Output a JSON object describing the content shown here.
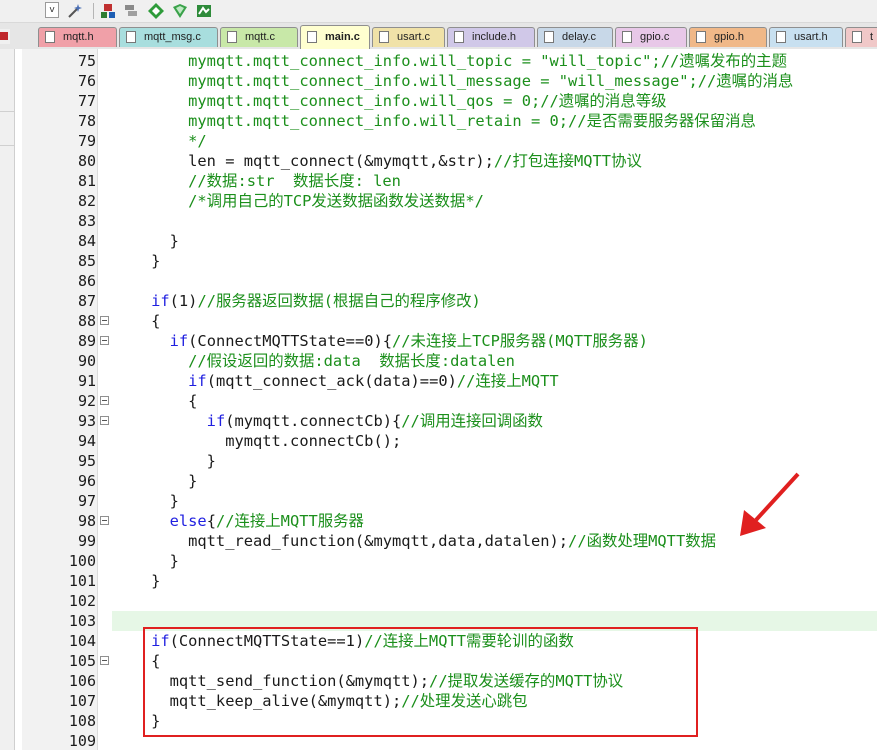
{
  "toolbar": {
    "dropdown_glyph": "v",
    "icons": [
      "dropdown-icon",
      "magic-wand-icon",
      "build-icon",
      "build-all-icon",
      "rebuild-icon",
      "download-icon",
      "options-icon"
    ]
  },
  "tabs": [
    {
      "label": "mqtt.h",
      "color": "#f0a0a8",
      "active": false
    },
    {
      "label": "mqtt_msg.c",
      "color": "#a8dede",
      "active": false
    },
    {
      "label": "mqtt.c",
      "color": "#c8e8a8",
      "active": false
    },
    {
      "label": "main.c",
      "color": "#ffffd0",
      "active": true
    },
    {
      "label": "usart.c",
      "color": "#f0e2a8",
      "active": false
    },
    {
      "label": "include.h",
      "color": "#d0c8e8",
      "active": false
    },
    {
      "label": "delay.c",
      "color": "#c8d8e8",
      "active": false
    },
    {
      "label": "gpio.c",
      "color": "#e8c8e8",
      "active": false
    },
    {
      "label": "gpio.h",
      "color": "#f0b888",
      "active": false
    },
    {
      "label": "usart.h",
      "color": "#c8e0f0",
      "active": false
    },
    {
      "label": "t",
      "color": "#f0c8c8",
      "active": false
    }
  ],
  "editor": {
    "current_line_highlight": 103,
    "lines": [
      {
        "n": "75",
        "fold": false,
        "segs": [
          {
            "t": "        mymqtt.mqtt_connect_info.will_topic = \"will_topic\";//遗嘱发布的主题",
            "c": "c-green"
          }
        ]
      },
      {
        "n": "76",
        "fold": false,
        "segs": [
          {
            "t": "        mymqtt.mqtt_connect_info.will_message = \"will_message\";//遗嘱的消息",
            "c": "c-green"
          }
        ]
      },
      {
        "n": "77",
        "fold": false,
        "segs": [
          {
            "t": "        mymqtt.mqtt_connect_info.will_qos = 0;//遗嘱的消息等级",
            "c": "c-green"
          }
        ]
      },
      {
        "n": "78",
        "fold": false,
        "segs": [
          {
            "t": "        mymqtt.mqtt_connect_info.will_retain = 0;//是否需要服务器保留消息",
            "c": "c-green"
          }
        ]
      },
      {
        "n": "79",
        "fold": false,
        "segs": [
          {
            "t": "        */",
            "c": "c-green"
          }
        ]
      },
      {
        "n": "80",
        "fold": false,
        "segs": [
          {
            "t": "        len = mqtt_connect(&mymqtt,&str);",
            "c": "c-black"
          },
          {
            "t": "//打包连接MQTT协议",
            "c": "c-green"
          }
        ]
      },
      {
        "n": "81",
        "fold": false,
        "segs": [
          {
            "t": "        //数据:str  数据长度: len",
            "c": "c-green"
          }
        ]
      },
      {
        "n": "82",
        "fold": false,
        "segs": [
          {
            "t": "        /*调用自己的TCP发送数据函数发送数据*/",
            "c": "c-green"
          }
        ]
      },
      {
        "n": "83",
        "fold": false,
        "segs": []
      },
      {
        "n": "84",
        "fold": false,
        "segs": [
          {
            "t": "      }",
            "c": "c-black"
          }
        ]
      },
      {
        "n": "85",
        "fold": false,
        "segs": [
          {
            "t": "    }",
            "c": "c-black"
          }
        ]
      },
      {
        "n": "86",
        "fold": false,
        "segs": []
      },
      {
        "n": "87",
        "fold": false,
        "segs": [
          {
            "t": "    ",
            "c": "c-black"
          },
          {
            "t": "if",
            "c": "kw"
          },
          {
            "t": "(1)",
            "c": "c-black"
          },
          {
            "t": "//服务器返回数据(根据自己的程序修改)",
            "c": "c-green"
          }
        ]
      },
      {
        "n": "88",
        "fold": true,
        "segs": [
          {
            "t": "    {",
            "c": "c-black"
          }
        ]
      },
      {
        "n": "89",
        "fold": true,
        "segs": [
          {
            "t": "      ",
            "c": "c-black"
          },
          {
            "t": "if",
            "c": "kw"
          },
          {
            "t": "(ConnectMQTTState==0){",
            "c": "c-black"
          },
          {
            "t": "//未连接上TCP服务器(MQTT服务器)",
            "c": "c-green"
          }
        ]
      },
      {
        "n": "90",
        "fold": false,
        "segs": [
          {
            "t": "        //假设返回的数据:data  数据长度:datalen",
            "c": "c-green"
          }
        ]
      },
      {
        "n": "91",
        "fold": false,
        "segs": [
          {
            "t": "        ",
            "c": "c-black"
          },
          {
            "t": "if",
            "c": "kw"
          },
          {
            "t": "(mqtt_connect_ack(data)==0)",
            "c": "c-black"
          },
          {
            "t": "//连接上MQTT",
            "c": "c-green"
          }
        ]
      },
      {
        "n": "92",
        "fold": true,
        "segs": [
          {
            "t": "        {",
            "c": "c-black"
          }
        ]
      },
      {
        "n": "93",
        "fold": true,
        "segs": [
          {
            "t": "          ",
            "c": "c-black"
          },
          {
            "t": "if",
            "c": "kw"
          },
          {
            "t": "(mymqtt.connectCb){",
            "c": "c-black"
          },
          {
            "t": "//调用连接回调函数",
            "c": "c-green"
          }
        ]
      },
      {
        "n": "94",
        "fold": false,
        "segs": [
          {
            "t": "            mymqtt.connectCb();",
            "c": "c-black"
          }
        ]
      },
      {
        "n": "95",
        "fold": false,
        "segs": [
          {
            "t": "          }",
            "c": "c-black"
          }
        ]
      },
      {
        "n": "96",
        "fold": false,
        "segs": [
          {
            "t": "        }",
            "c": "c-black"
          }
        ]
      },
      {
        "n": "97",
        "fold": false,
        "segs": [
          {
            "t": "      }",
            "c": "c-black"
          }
        ]
      },
      {
        "n": "98",
        "fold": true,
        "segs": [
          {
            "t": "      ",
            "c": "c-black"
          },
          {
            "t": "else",
            "c": "kw"
          },
          {
            "t": "{",
            "c": "c-black"
          },
          {
            "t": "//连接上MQTT服务器",
            "c": "c-green"
          }
        ]
      },
      {
        "n": "99",
        "fold": false,
        "segs": [
          {
            "t": "        mqtt_read_function(&mymqtt,data,datalen);",
            "c": "c-black"
          },
          {
            "t": "//函数处理MQTT数据",
            "c": "c-green"
          }
        ]
      },
      {
        "n": "100",
        "fold": false,
        "segs": [
          {
            "t": "      }",
            "c": "c-black"
          }
        ]
      },
      {
        "n": "101",
        "fold": false,
        "segs": [
          {
            "t": "    }",
            "c": "c-black"
          }
        ]
      },
      {
        "n": "102",
        "fold": false,
        "segs": []
      },
      {
        "n": "103",
        "fold": false,
        "segs": []
      },
      {
        "n": "104",
        "fold": false,
        "segs": [
          {
            "t": "    ",
            "c": "c-black"
          },
          {
            "t": "if",
            "c": "kw"
          },
          {
            "t": "(ConnectMQTTState==1)",
            "c": "c-black"
          },
          {
            "t": "//连接上MQTT需要轮训的函数",
            "c": "c-green"
          }
        ]
      },
      {
        "n": "105",
        "fold": true,
        "segs": [
          {
            "t": "    {",
            "c": "c-black"
          }
        ]
      },
      {
        "n": "106",
        "fold": false,
        "segs": [
          {
            "t": "      mqtt_send_function(&mymqtt);",
            "c": "c-black"
          },
          {
            "t": "//提取发送缓存的MQTT协议",
            "c": "c-green"
          }
        ]
      },
      {
        "n": "107",
        "fold": false,
        "segs": [
          {
            "t": "      mqtt_keep_alive(&mymqtt);",
            "c": "c-black"
          },
          {
            "t": "//处理发送心跳包",
            "c": "c-green"
          }
        ]
      },
      {
        "n": "108",
        "fold": false,
        "segs": [
          {
            "t": "    }",
            "c": "c-black"
          }
        ]
      },
      {
        "n": "109",
        "fold": false,
        "segs": []
      }
    ]
  },
  "annotations": {
    "box_color": "#e02020",
    "arrow_color": "#e02020"
  }
}
